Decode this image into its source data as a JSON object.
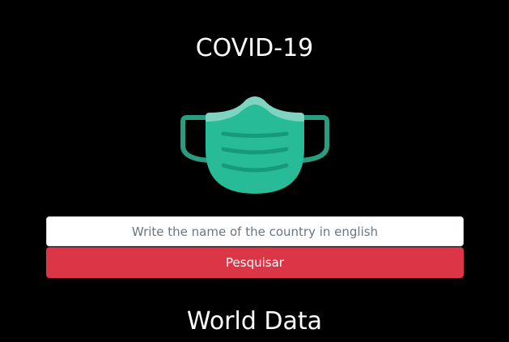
{
  "header": {
    "title": "COVID-19",
    "logo_icon": "face-mask-icon"
  },
  "search": {
    "placeholder": "Write the name of the country in english",
    "value": "",
    "button_label": "Pesquisar"
  },
  "section": {
    "title": "World Data"
  },
  "colors": {
    "background": "#000000",
    "text": "#ffffff",
    "button": "#dc3545",
    "mask_main": "#27bb98",
    "mask_light": "#7fd3c0",
    "mask_strap": "#2a9d80",
    "mask_fold": "#169a7a"
  }
}
